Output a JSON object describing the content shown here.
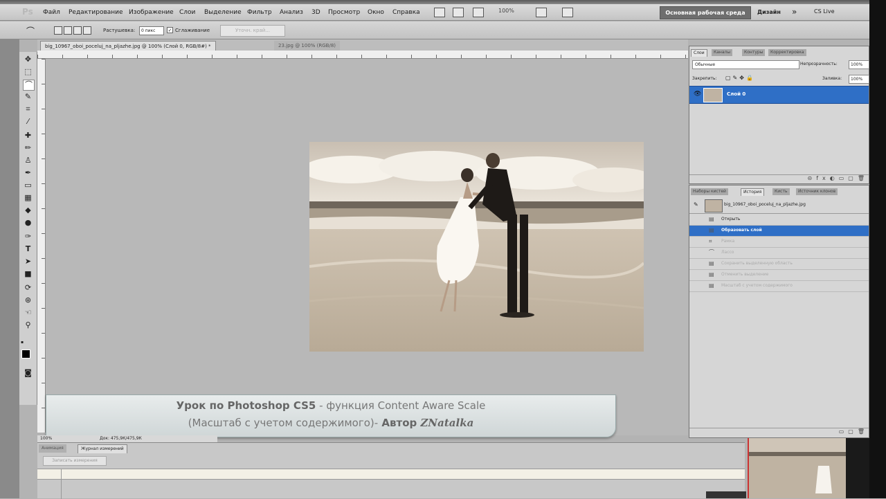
{
  "app": {
    "logo": "Ps"
  },
  "menu": {
    "items": [
      "Файл",
      "Редактирование",
      "Изображение",
      "Слои",
      "Выделение",
      "Фильтр",
      "Анализ",
      "3D",
      "Просмотр",
      "Окно",
      "Справка"
    ],
    "zoom": "100%",
    "workspace_button": "Основная рабочая среда",
    "design": "Дизайн",
    "more": "»",
    "cslive": "CS Live"
  },
  "options": {
    "feather_label": "Растушевка:",
    "feather_value": "0 пикс",
    "antialias_label": "Сглаживание",
    "refine_button": "Уточн. край..."
  },
  "documents": {
    "tab1": "big_10967_oboi_poceluj_na_pljazhe.jpg @ 100% (Слой 0, RGB/8#) *",
    "tab2": "23.jpg @ 100% (RGB/8)"
  },
  "banner": {
    "line1_a": "Урок по Photoshop CS5",
    "line1_b": " - функция ",
    "line1_c": "Content Aware Scale",
    "line2_a": "(Масштаб с учетом содержимого)-",
    "line2_b": " Автор ",
    "line2_c": "ZNatalka"
  },
  "status": {
    "zoom": "100%",
    "doc": "Док: 475,9К/475,9К"
  },
  "bottom_panel": {
    "tab1": "Анимация",
    "tab2": "Журнал измерений",
    "record_button": "Записать измерения"
  },
  "layers_panel": {
    "tabs": [
      "Слои",
      "Каналы",
      "Контуры",
      "Корректировка"
    ],
    "blend_mode": "Обычные",
    "opacity_label": "Непрозрачность:",
    "opacity_value": "100%",
    "lock_label": "Закрепить:",
    "fill_label": "Заливка:",
    "fill_value": "100%",
    "layer_name": "Слой 0"
  },
  "history_panel": {
    "tabs": [
      "Наборы кистей",
      "История",
      "Кисть",
      "Источник клонов"
    ],
    "snapshot": "big_10967_oboi_poceluj_na_pljazhe.jpg",
    "items": [
      {
        "label": "Открыть",
        "state": "normal",
        "icon": "open-icon"
      },
      {
        "label": "Образовать слой",
        "state": "selected",
        "icon": "layer-icon"
      },
      {
        "label": "Рамка",
        "state": "dim",
        "icon": "crop-icon"
      },
      {
        "label": "Лассо",
        "state": "dim",
        "icon": "lasso-icon"
      },
      {
        "label": "Сохранить выделенную область",
        "state": "dim",
        "icon": "save-icon"
      },
      {
        "label": "Отменить выделение",
        "state": "dim",
        "icon": "deselect-icon"
      },
      {
        "label": "Масштаб с учетом содержимого",
        "state": "dim",
        "icon": "scale-icon"
      }
    ]
  }
}
